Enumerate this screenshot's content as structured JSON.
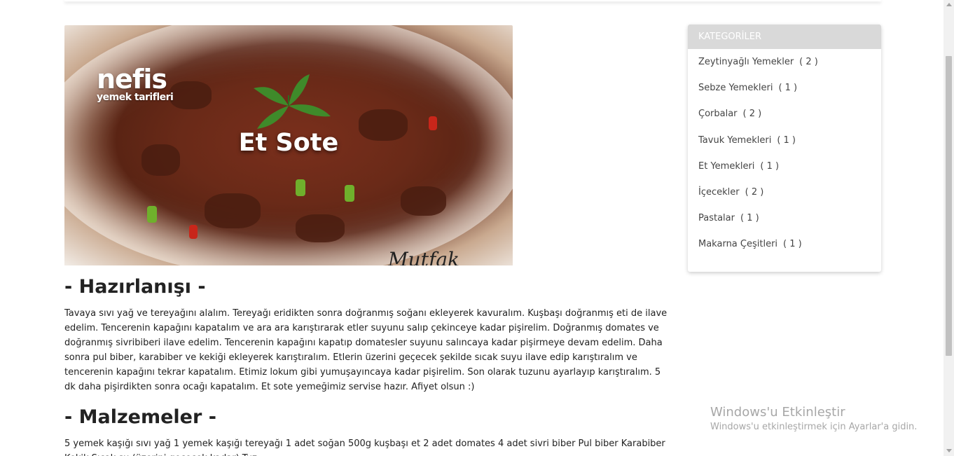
{
  "recipe": {
    "hero_title": "Et Sote",
    "logo_brand": "nefis",
    "logo_sub": "yemek tarifleri",
    "signature": "Mutfak",
    "preparation_title": "- Hazırlanışı -",
    "preparation_text": "Tavaya sıvı yağ ve tereyağını alalım. Tereyağı eridikten sonra doğranmış soğanı ekleyerek kavuralım. Kuşbaşı doğranmış eti de ilave edelim. Tencerenin kapağını kapatalım ve ara ara karıştırarak etler suyunu salıp çekinceye kadar pişirelim. Doğranmış domates ve doğranmış sivribiberi ilave edelim. Tencerenin kapağını kapatıp domatesler suyunu salıncaya kadar pişirmeye devam edelim. Daha sonra pul biber, karabiber ve kekiği ekleyerek karıştıralım. Etlerin üzerini geçecek şekilde sıcak suyu ilave edip karıştıralım ve tencerenin kapağını tekrar kapatalım. Etimiz lokum gibi yumuşayıncaya kadar pişirelim. Son olarak tuzunu ayarlayıp karıştıralım. 5 dk daha pişirdikten sonra ocağı kapatalım. Et sote yemeğimiz servise hazır. Afiyet olsun :)",
    "ingredients_title": "- Malzemeler -",
    "ingredients_text": "5 yemek kaşığı sıvı yağ 1 yemek kaşığı tereyağı 1 adet soğan 500g kuşbaşı et 2 adet domates 4 adet sivri biber Pul biber Karabiber Kekik Sıcak su (üzerini geçecek kadar) Tuz"
  },
  "sidebar": {
    "header": "KATEGORİLER",
    "items": [
      {
        "label": "Zeytinyağlı Yemekler",
        "count": "( 2 )"
      },
      {
        "label": "Sebze Yemekleri",
        "count": "( 1 )"
      },
      {
        "label": "Çorbalar",
        "count": "( 2 )"
      },
      {
        "label": "Tavuk Yemekleri",
        "count": "( 1 )"
      },
      {
        "label": "Et Yemekleri",
        "count": "( 1 )"
      },
      {
        "label": "İçecekler",
        "count": "( 2 )"
      },
      {
        "label": "Pastalar",
        "count": "( 1 )"
      },
      {
        "label": "Makarna Çeşitleri",
        "count": "( 1 )"
      }
    ]
  },
  "activation": {
    "title": "Windows'u Etkinleştir",
    "subtitle": "Windows'u etkinleştirmek için Ayarlar'a gidin."
  }
}
